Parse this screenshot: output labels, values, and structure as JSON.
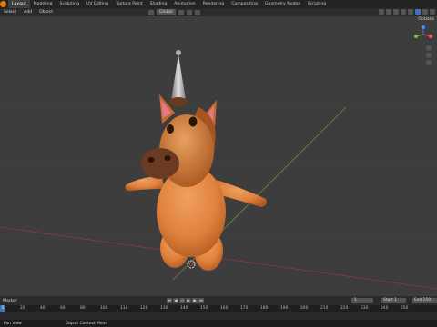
{
  "workspace_tabs": [
    "Layout",
    "Modeling",
    "Sculpting",
    "UV Editing",
    "Texture Paint",
    "Shading",
    "Animation",
    "Rendering",
    "Compositing",
    "Geometry Nodes",
    "Scripting"
  ],
  "active_tab": "Layout",
  "toolbar": {
    "select": "Select",
    "add": "Add",
    "object": "Object",
    "orientation": "Global"
  },
  "viewport": {
    "options_label": "Options"
  },
  "timeline": {
    "label": "Marker",
    "current_frame": "1",
    "start_label": "Start",
    "start_value": "1",
    "end_label": "End",
    "end_value": "250"
  },
  "ruler_ticks": [
    "0",
    "20",
    "40",
    "60",
    "80",
    "100",
    "110",
    "120",
    "130",
    "140",
    "150",
    "160",
    "170",
    "180",
    "190",
    "200",
    "210",
    "220",
    "230",
    "240",
    "250"
  ],
  "status": {
    "pan_view": "Pan View",
    "context_menu": "Object Context Menu"
  },
  "colors": {
    "accent": "#4772b3",
    "brand_orange": "#e87d0d",
    "character": "#e0823d"
  }
}
